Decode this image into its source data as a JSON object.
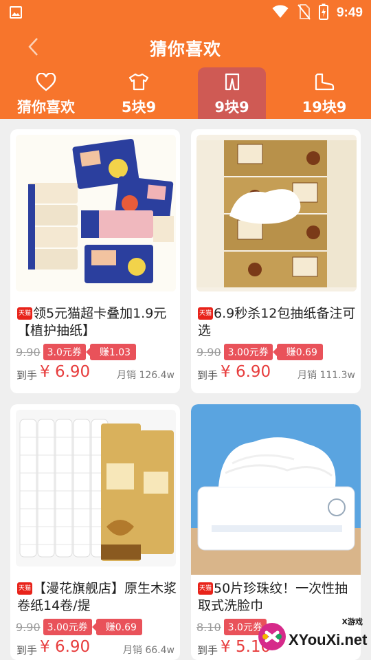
{
  "status_bar": {
    "time": "9:49"
  },
  "header": {
    "title": "猜你喜欢"
  },
  "tabs": [
    {
      "label": "猜你喜欢",
      "icon": "heart-icon",
      "active": false
    },
    {
      "label": "5块9",
      "icon": "shirt-icon",
      "active": false
    },
    {
      "label": "9块9",
      "icon": "pants-icon",
      "active": true
    },
    {
      "label": "19块9",
      "icon": "boot-icon",
      "active": false
    }
  ],
  "products": [
    {
      "badge": "天猫",
      "title": "领5元猫超卡叠加1.9元【植护抽纸】",
      "original_price": "9.90",
      "coupon": "3.0元券",
      "rebate": "赚1.03",
      "final_label": "到手",
      "final_price": "¥ 6.90",
      "sales": "月销 126.4w"
    },
    {
      "badge": "天猫",
      "title": "6.9秒杀12包抽纸备注可选",
      "original_price": "9.90",
      "coupon": "3.00元券",
      "rebate": "赚0.69",
      "final_label": "到手",
      "final_price": "¥ 6.90",
      "sales": "月销 111.3w"
    },
    {
      "badge": "天猫",
      "title": "【漫花旗舰店】原生木浆卷纸14卷/提",
      "original_price": "9.90",
      "coupon": "3.00元券",
      "rebate": "赚0.69",
      "final_label": "到手",
      "final_price": "¥ 6.90",
      "sales": "月销 66.4w"
    },
    {
      "badge": "天猫",
      "title": "50片珍珠纹！一次性抽取式洗脸巾",
      "original_price": "8.10",
      "coupon": "3.0元券",
      "rebate": "",
      "final_label": "到手",
      "final_price": "¥ 5.10",
      "sales": ""
    }
  ],
  "watermark": {
    "small_text": "X游戏",
    "site": "XYouXi.net"
  },
  "colors": {
    "header": "#f7752c",
    "active_tab": "#cf5a54",
    "price": "#e73d3d",
    "coupon": "#e9525a",
    "tmall": "#e8231a"
  }
}
